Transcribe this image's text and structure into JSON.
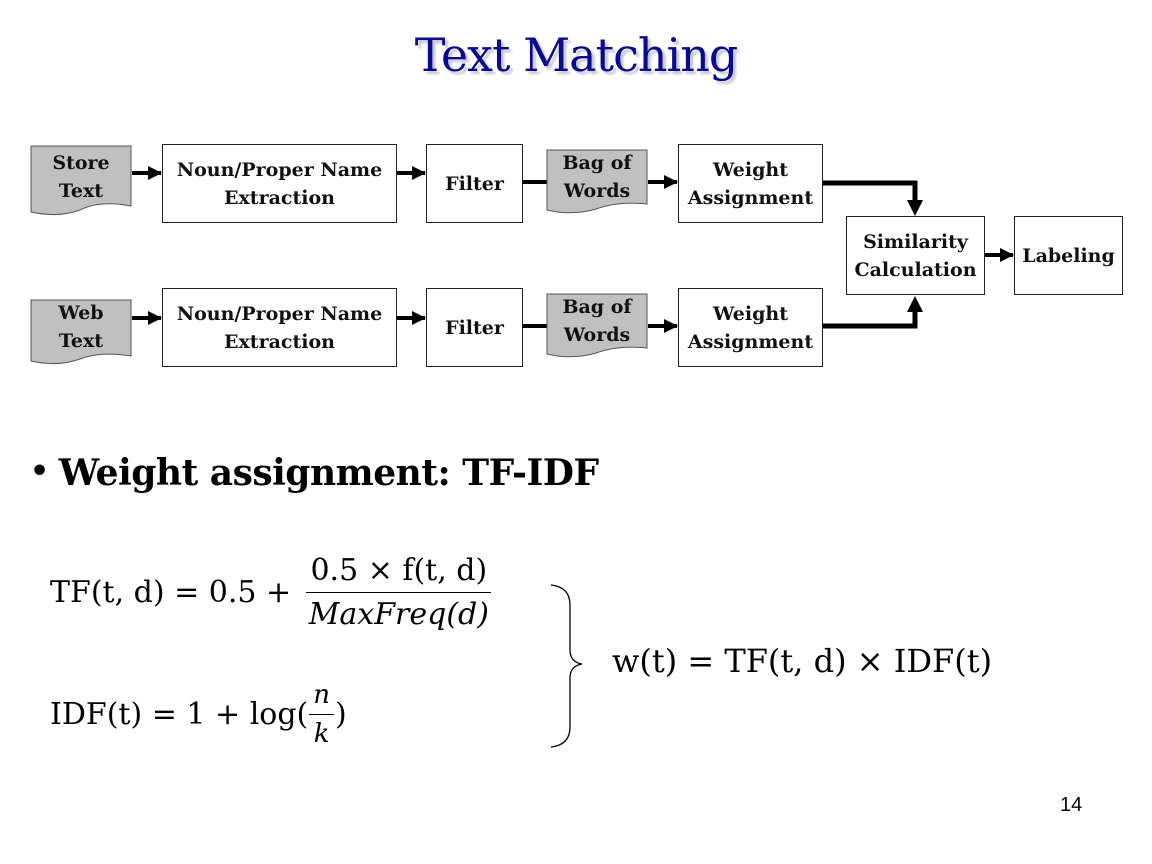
{
  "slide": {
    "title": "Text Matching",
    "page_number": "14",
    "title_color": "#0a0a8c"
  },
  "diagram": {
    "row1": {
      "source": [
        "Store",
        "Text"
      ],
      "extraction": [
        "Noun/Proper Name",
        "Extraction"
      ],
      "filter": "Filter",
      "bag": [
        "Bag of",
        "Words"
      ],
      "weight": [
        "Weight",
        "Assignment"
      ]
    },
    "row2": {
      "source": [
        "Web",
        "Text"
      ],
      "extraction": [
        "Noun/Proper Name",
        "Extraction"
      ],
      "filter": "Filter",
      "bag": [
        "Bag of",
        "Words"
      ],
      "weight": [
        "Weight",
        "Assignment"
      ]
    },
    "similarity": [
      "Similarity",
      "Calculation"
    ],
    "labeling": "Labeling",
    "doc_fill": "#c0c0c0"
  },
  "bullet": {
    "symbol": "•",
    "text": "Weight assignment:  TF-IDF"
  },
  "formulas": {
    "tf": {
      "lhs": "TF(t, d) = 0.5 +",
      "numerator": "0.5 × f(t, d)",
      "denominator": "MaxFreq(d)"
    },
    "idf": {
      "lhs": "IDF(t) = 1 + log(",
      "numerator": "n",
      "denominator": "k",
      "close": ")"
    },
    "weight": "w(t) = TF(t, d) × IDF(t)"
  }
}
